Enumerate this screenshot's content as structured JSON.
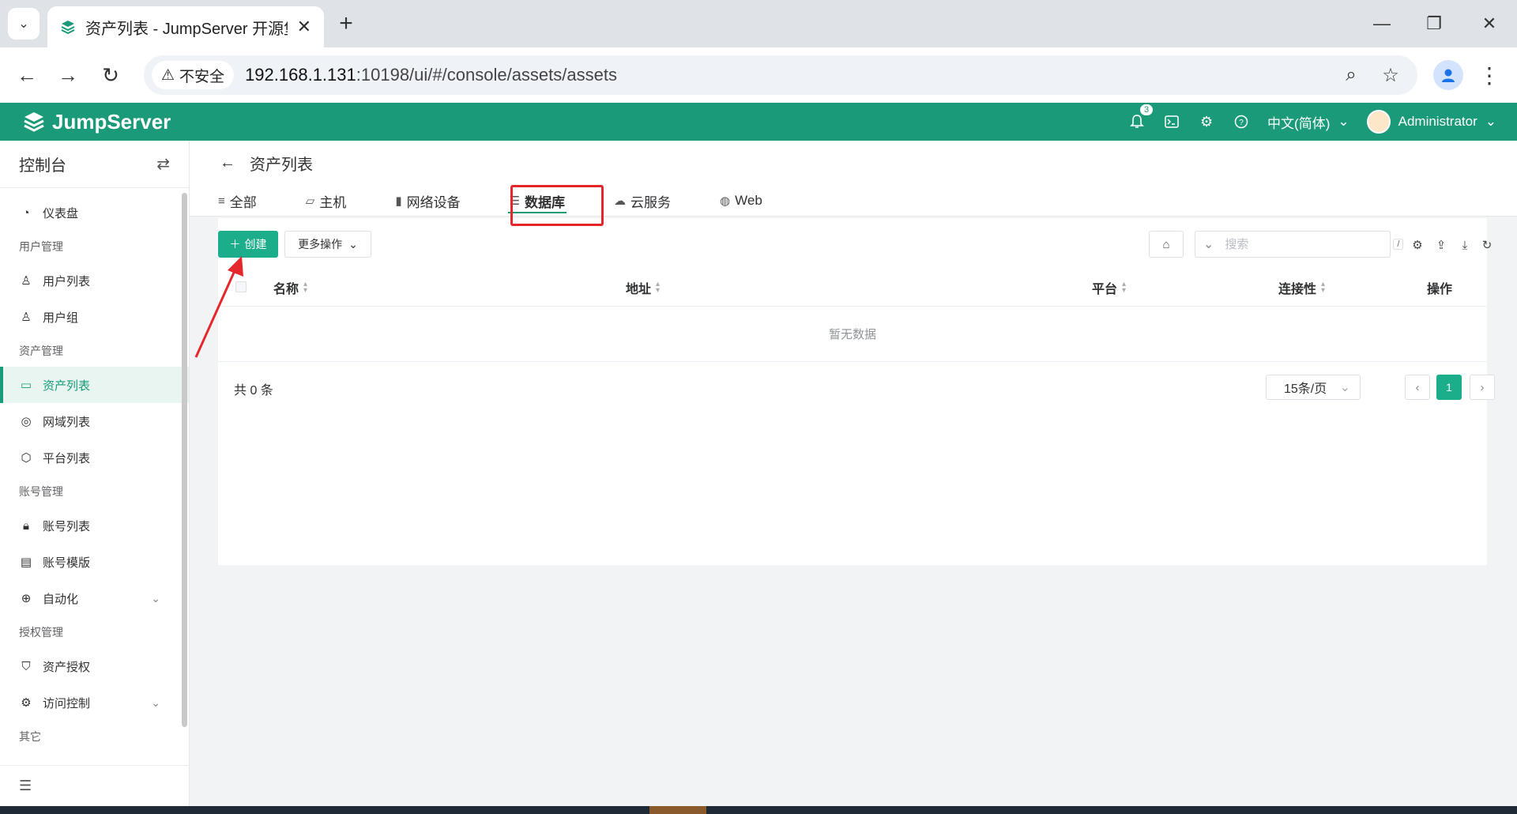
{
  "browser": {
    "tab_title": "资产列表 - JumpServer 开源堡垒机",
    "insecure_label": "不安全",
    "url_host": "192.168.1.131",
    "url_rest": ":10198/ui/#/console/assets/assets"
  },
  "header": {
    "brand": "JumpServer",
    "notification_count": "3",
    "language": "中文(简体)",
    "user": "Administrator"
  },
  "sidebar": {
    "title": "控制台",
    "groups": [
      {
        "label": ""
      },
      {
        "label": "用户管理"
      },
      {
        "label": "资产管理"
      },
      {
        "label": "账号管理"
      },
      {
        "label": "授权管理"
      },
      {
        "label": "其它"
      }
    ],
    "items": [
      {
        "label": "仪表盘"
      },
      {
        "label": "用户列表"
      },
      {
        "label": "用户组"
      },
      {
        "label": "资产列表"
      },
      {
        "label": "网域列表"
      },
      {
        "label": "平台列表"
      },
      {
        "label": "账号列表"
      },
      {
        "label": "账号模版"
      },
      {
        "label": "自动化"
      },
      {
        "label": "资产授权"
      },
      {
        "label": "访问控制"
      }
    ]
  },
  "page": {
    "title": "资产列表",
    "tabs": [
      {
        "label": "全部"
      },
      {
        "label": "主机"
      },
      {
        "label": "网络设备"
      },
      {
        "label": "数据库"
      },
      {
        "label": "云服务"
      },
      {
        "label": "Web"
      }
    ],
    "active_tab": "数据库"
  },
  "toolbar": {
    "create_label": "创建",
    "more_label": "更多操作",
    "search_placeholder": "搜索",
    "search_shortcut": "/"
  },
  "table": {
    "columns": [
      {
        "label": "名称"
      },
      {
        "label": "地址"
      },
      {
        "label": "平台"
      },
      {
        "label": "连接性"
      },
      {
        "label": "操作"
      }
    ],
    "empty_text": "暂无数据"
  },
  "pagination": {
    "total_text": "共 0 条",
    "page_size": "15条/页",
    "current_page": "1"
  },
  "colors": {
    "brand": "#1a9a78",
    "primary_button": "#1cae8a",
    "annotation": "#e5262b"
  }
}
